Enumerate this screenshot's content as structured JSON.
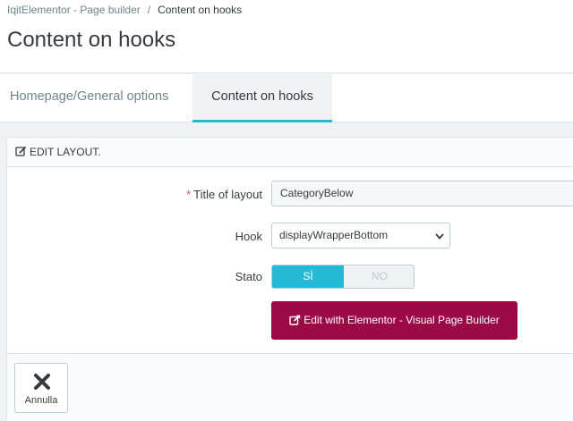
{
  "breadcrumb": {
    "parent": "IqitElementor - Page builder",
    "separator": "/",
    "current": "Content on hooks"
  },
  "page_title": "Content on hooks",
  "tabs": [
    {
      "label": "Homepage/General options",
      "active": false
    },
    {
      "label": "Content on hooks",
      "active": true
    }
  ],
  "panel": {
    "heading": "Edit layout.",
    "heading_icon": "edit-icon",
    "fields": {
      "title": {
        "required_mark": "*",
        "label": "Title of layout",
        "value": "CategoryBelow"
      },
      "hook": {
        "label": "Hook",
        "value": "displayWrapperBottom"
      },
      "stato": {
        "label": "Stato",
        "on_label": "SÌ",
        "off_label": "NO",
        "value": "on"
      }
    },
    "elementor_button": {
      "label": "Edit with Elementor - Visual Page Builder",
      "icon": "external-link-icon"
    },
    "footer": {
      "cancel_label": "Annulla",
      "cancel_icon": "close-icon"
    }
  },
  "colors": {
    "accent": "#25b9d7",
    "elementor": "#9b0a45",
    "required": "#c05c67",
    "background": "#eff1f2"
  }
}
